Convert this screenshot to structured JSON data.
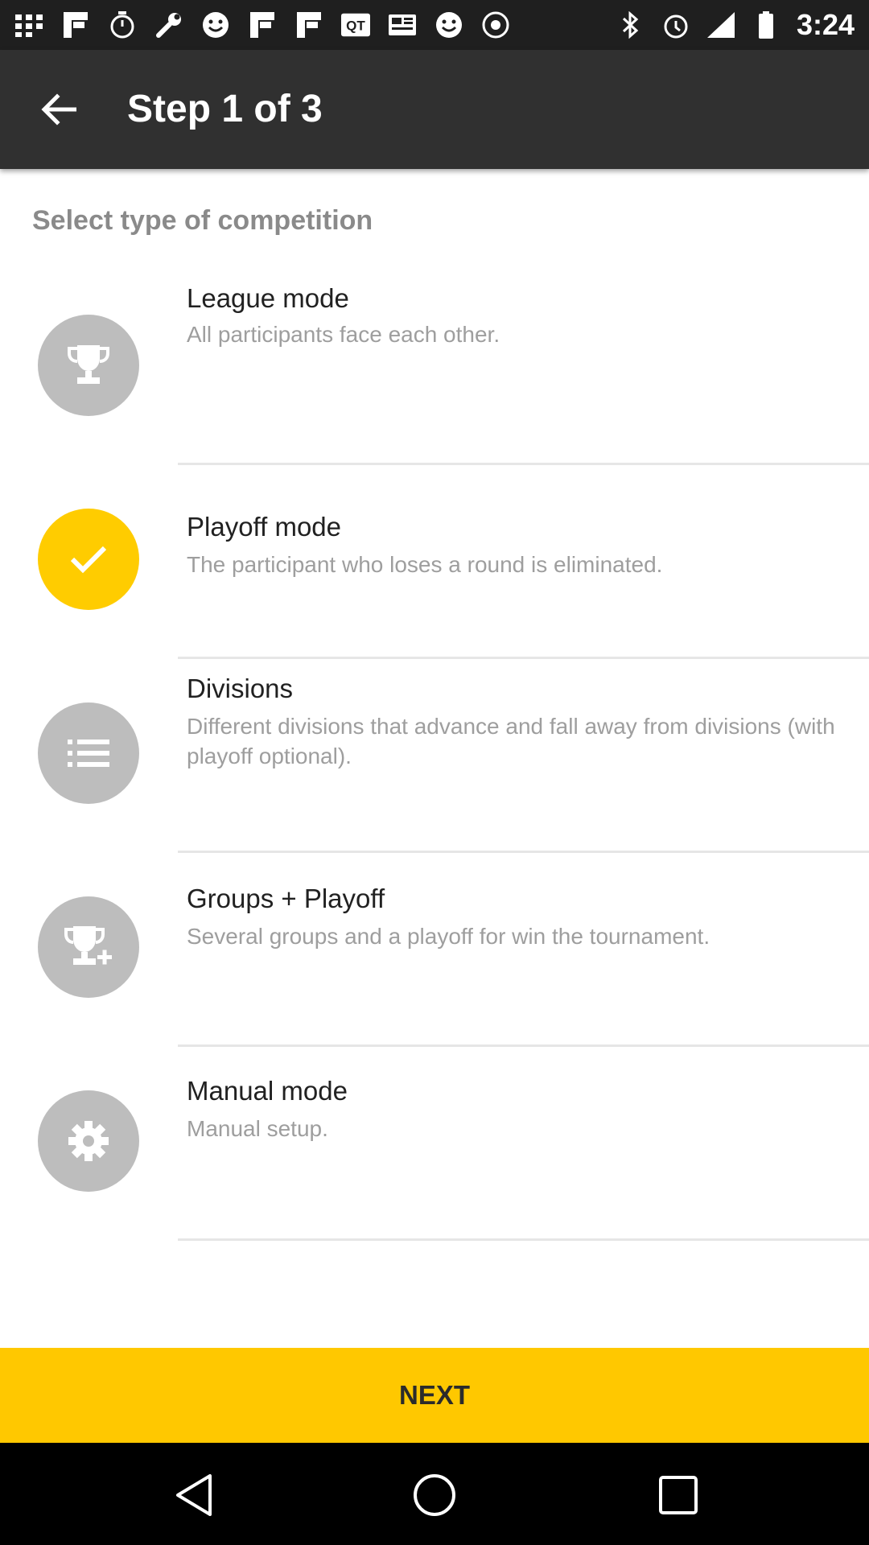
{
  "status": {
    "time": "3:24",
    "left_icons": [
      "apps-icon",
      "flipboard-icon",
      "timer-icon",
      "wrench-icon",
      "smiley-icon",
      "flipboard-icon",
      "flipboard-icon",
      "qt-icon",
      "newspaper-icon",
      "smiley-icon",
      "settings-icon"
    ],
    "right_icons": [
      "bluetooth-icon",
      "alarm-icon",
      "signal-icon",
      "battery-icon"
    ]
  },
  "header": {
    "title": "Step 1 of 3",
    "back_icon": "back-arrow-icon"
  },
  "section": {
    "title": "Select type of competition"
  },
  "items": [
    {
      "title": "League mode",
      "desc": "All participants face each other.",
      "icon": "trophy-icon",
      "selected": false
    },
    {
      "title": "Playoff mode",
      "desc": "The participant who loses a round is eliminated.",
      "icon": "check-icon",
      "selected": true
    },
    {
      "title": "Divisions",
      "desc": "Different divisions that advance and fall away from divisions (with playoff optional).",
      "icon": "list-icon",
      "selected": false
    },
    {
      "title": "Groups + Playoff",
      "desc": "Several groups and a playoff for win the tournament.",
      "icon": "trophy-plus-icon",
      "selected": false
    },
    {
      "title": "Manual mode",
      "desc": "Manual setup.",
      "icon": "gear-icon",
      "selected": false
    }
  ],
  "next_button": {
    "label": "NEXT"
  },
  "colors": {
    "accent": "#ffc800",
    "appbar": "#303030",
    "icon_circle": "#bdbdbd"
  },
  "navbar": {
    "back_icon": "nav-back-icon",
    "home_icon": "nav-home-icon",
    "recents_icon": "nav-recents-icon"
  }
}
